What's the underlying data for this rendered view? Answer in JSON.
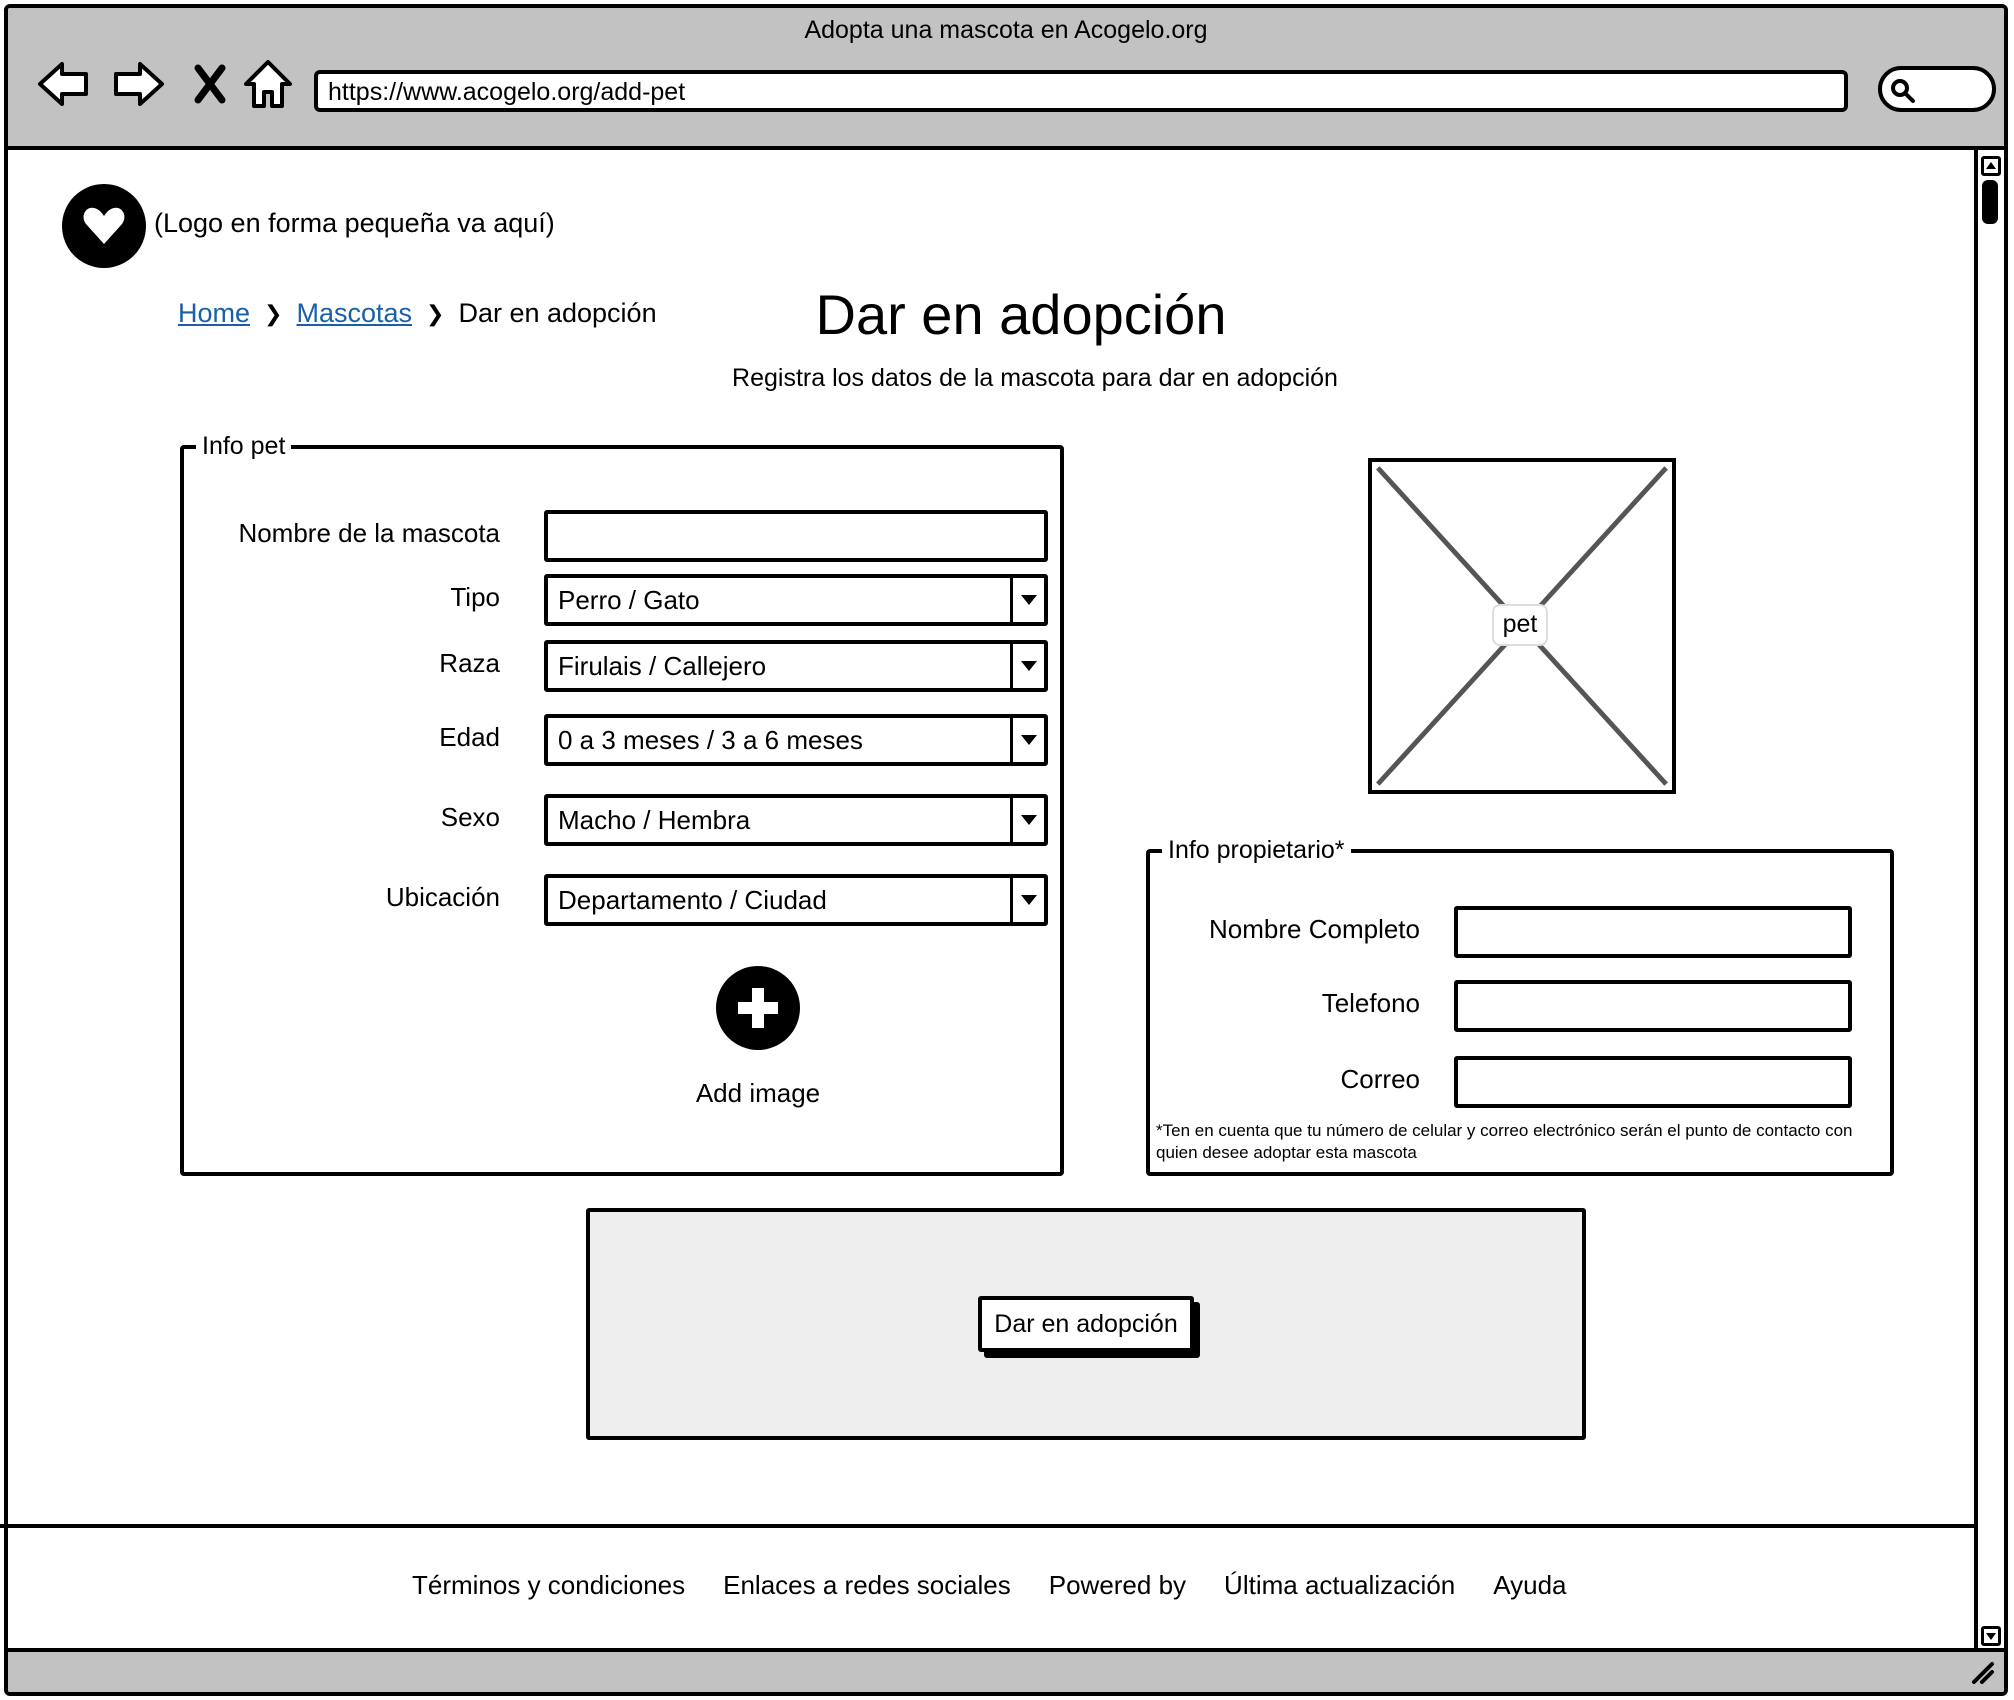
{
  "window": {
    "title": "Adopta una mascota en Acogelo.org",
    "url": "https://www.acogelo.org/add-pet"
  },
  "icons": {
    "back": "back-arrow-icon",
    "forward": "forward-arrow-icon",
    "stop": "close-icon",
    "home": "home-icon",
    "search": "search-icon",
    "logo": "heart-icon",
    "add_image": "plus-circle-icon",
    "dropdown": "chevron-down-icon"
  },
  "logo": {
    "text": "(Logo en forma pequeña va aquí)"
  },
  "breadcrumb": {
    "home": "Home",
    "mascotas": "Mascotas",
    "current": "Dar en adopción"
  },
  "header": {
    "title": "Dar en adopción",
    "subtitle": "Registra los datos de la mascota para dar en adopción"
  },
  "pet_info": {
    "legend": "Info pet",
    "name_label": "Nombre de la mascota",
    "name_value": "",
    "type_label": "Tipo",
    "type_value": "Perro / Gato",
    "breed_label": "Raza",
    "breed_value": "Firulais / Callejero",
    "age_label": "Edad",
    "age_value": "0 a 3 meses / 3 a 6 meses",
    "sex_label": "Sexo",
    "sex_value": "Macho / Hembra",
    "location_label": "Ubicación",
    "location_value": "Departamento / Ciudad",
    "add_image_label": "Add image"
  },
  "image_placeholder": {
    "label": "pet"
  },
  "owner_info": {
    "legend": "Info propietario*",
    "fullname_label": "Nombre Completo",
    "fullname_value": "",
    "phone_label": "Telefono",
    "phone_value": "",
    "email_label": "Correo",
    "email_value": "",
    "note": "*Ten en cuenta que tu número de celular y correo electrónico serán el punto de contacto con quien desee adoptar esta mascota"
  },
  "actions": {
    "submit_label": "Dar en adopción"
  },
  "footer": {
    "terms": "Términos y condiciones",
    "social": "Enlaces a redes sociales",
    "powered": "Powered by",
    "updated": "Última actualización",
    "help": "Ayuda"
  }
}
